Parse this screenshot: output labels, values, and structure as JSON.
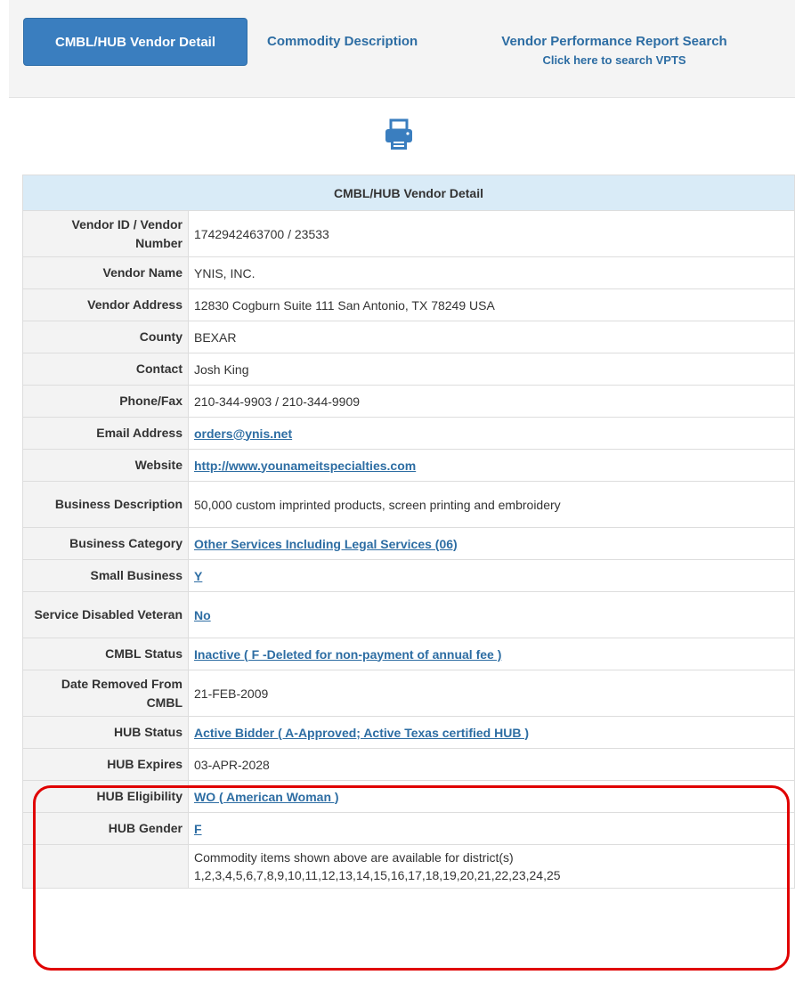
{
  "nav": {
    "active_tab": "CMBL/HUB Vendor Detail",
    "commodity_link": "Commodity Description",
    "vpts_link": "Vendor Performance Report Search",
    "vpts_sub": "Click here to search VPTS"
  },
  "icons": {
    "print": "printer-icon"
  },
  "table": {
    "title": "CMBL/HUB Vendor Detail",
    "rows": [
      {
        "label": "Vendor ID / Vendor Number",
        "value": "1742942463700 / 23533",
        "link": false
      },
      {
        "label": "Vendor Name",
        "value": "YNIS, INC.",
        "link": false
      },
      {
        "label": "Vendor Address",
        "value": "12830 Cogburn Suite 111 San Antonio, TX 78249 USA",
        "link": false
      },
      {
        "label": "County",
        "value": "BEXAR",
        "link": false
      },
      {
        "label": "Contact",
        "value": "Josh King",
        "link": false
      },
      {
        "label": "Phone/Fax",
        "value": "210-344-9903 / 210-344-9909",
        "link": false
      },
      {
        "label": "Email Address",
        "value": "orders@ynis.net",
        "link": true
      },
      {
        "label": "Website",
        "value": "http://www.younameitspecialties.com",
        "link": true
      },
      {
        "label": "Business Description",
        "value": "50,000 custom imprinted products, screen printing and embroidery",
        "link": false
      },
      {
        "label": "Business Category",
        "value": "Other Services Including Legal Services (06)",
        "link": true
      },
      {
        "label": "Small Business",
        "value": "Y",
        "link": true
      },
      {
        "label": "Service Disabled Veteran",
        "value": "No",
        "link": true
      },
      {
        "label": "CMBL Status",
        "value": "Inactive ( F -Deleted for non-payment of annual fee )",
        "link": true
      },
      {
        "label": "Date Removed From CMBL",
        "value": "21-FEB-2009",
        "link": false
      },
      {
        "label": "HUB Status",
        "value": "Active Bidder ( A-Approved; Active Texas certified HUB )",
        "link": true
      },
      {
        "label": "HUB Expires",
        "value": "03-APR-2028",
        "link": false
      },
      {
        "label": "HUB Eligibility",
        "value": "WO ( American Woman )",
        "link": true
      },
      {
        "label": "HUB Gender",
        "value": "F",
        "link": true
      }
    ],
    "footer_note": "Commodity items shown above are available for district(s) 1,2,3,4,5,6,7,8,9,10,11,12,13,14,15,16,17,18,19,20,21,22,23,24,25"
  },
  "colors": {
    "accent": "#3a7ebf",
    "link": "#2d6da3",
    "header_bg": "#d9ebf7",
    "highlight": "#e00000"
  }
}
